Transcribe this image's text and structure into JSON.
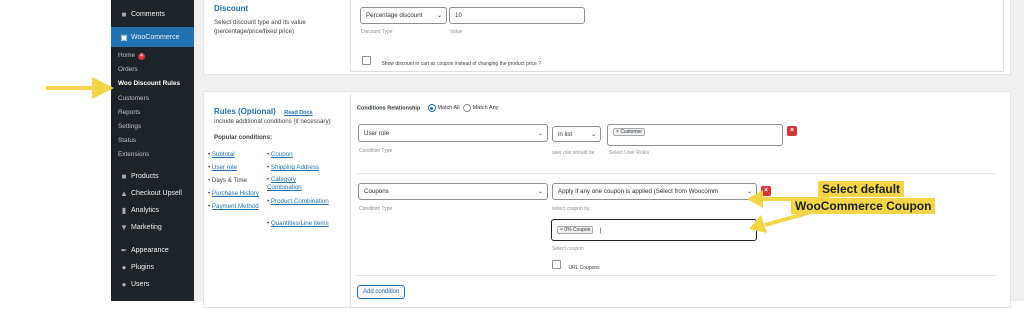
{
  "sidebar": {
    "comments": "Comments",
    "woocommerce": "WooCommerce",
    "home": "Home",
    "home_badge": "4",
    "orders": "Orders",
    "woo_discount_rules": "Woo Discount Rules",
    "customers": "Customers",
    "reports": "Reports",
    "settings": "Settings",
    "status": "Status",
    "extensions": "Extensions",
    "products": "Products",
    "checkout_upsell": "Checkout Upsell",
    "analytics": "Analytics",
    "marketing": "Marketing",
    "appearance": "Appearance",
    "plugins": "Plugins",
    "users": "Users"
  },
  "discount": {
    "title": "Discount",
    "description": "Select discount type and its value (percentage/price/fixed price)",
    "type_value": "Percentage discount",
    "type_label": "Discount Type",
    "value": "10",
    "value_label": "Value",
    "coupon_checkbox_label": "Show discount in cart as coupon instead of changing the product price ?"
  },
  "rules": {
    "title": "Rules (Optional)",
    "read_docs": "Read Docs",
    "description": "Include additional conditions (if necessary)",
    "popular_heading": "Popular conditions:",
    "popular_left": [
      "Subtotal",
      "User role",
      "Days & Time",
      "Purchase History",
      "Payment Method"
    ],
    "popular_right": [
      "Coupon",
      "Shipping Address",
      "Category Combination",
      "Product Combination",
      "Quantities/Line items"
    ],
    "relationship_label": "Conditions Relationship",
    "match_all": "Match All",
    "match_any": "Match Any",
    "condition1": {
      "type": "User role",
      "type_label": "Condition Type",
      "operator": "in list",
      "operator_label": "user role should be",
      "tag": "Customer",
      "value_label": "Select User Roles"
    },
    "condition2": {
      "type": "Coupons",
      "type_label": "Condition Type",
      "operator": "Apply if any one coupon is applied (Select from Woocomm",
      "operator_label": "select coupon by",
      "tag": "0% Coupon",
      "value_label": "Select coupon",
      "url_coupons": "URL Coupons"
    },
    "add_condition": "Add condition"
  },
  "callout": {
    "line1": "Select default",
    "line2": "WooCommerce Coupon"
  },
  "colors": {
    "accent": "#2271b1",
    "sidebar": "#1d2327",
    "highlight": "#f5d547",
    "danger": "#d63638"
  }
}
